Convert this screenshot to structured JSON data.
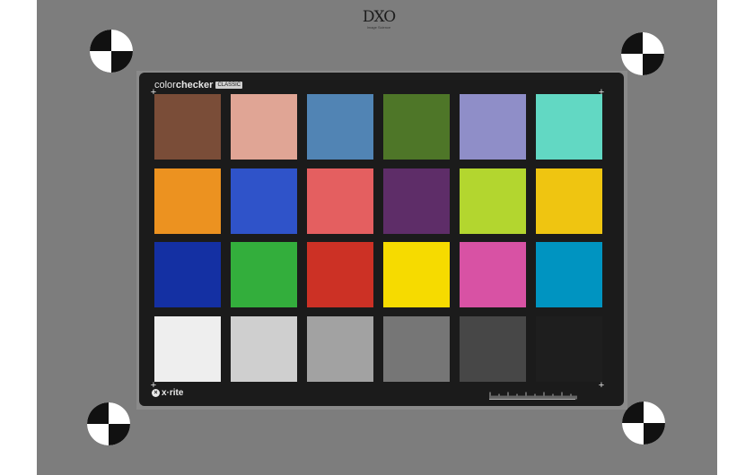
{
  "branding": {
    "dxo_logo": "DXO",
    "dxo_tagline": "Image Science",
    "chart_name_light": "color",
    "chart_name_bold": "checker",
    "chart_edition": "CLASSIC",
    "maker_logo": "x·rite"
  },
  "colors": {
    "board": "#7d7d7d",
    "chart_frame": "#1b1b1b"
  },
  "swatches": [
    [
      "#7a4d38",
      "#e0a595",
      "#5184b4",
      "#4e7628",
      "#8f8ec8",
      "#62d8c3"
    ],
    [
      "#ec9220",
      "#2f53c9",
      "#e45f60",
      "#5e2d68",
      "#b3d62f",
      "#efc511"
    ],
    [
      "#1430a3",
      "#33ae3c",
      "#cc3125",
      "#f6db00",
      "#d852a4",
      "#0094c1"
    ],
    [
      "#eeeeee",
      "#cfcfcf",
      "#a2a2a2",
      "#767676",
      "#474747",
      "#1e1e1e"
    ]
  ],
  "icons": {
    "registration_target": "quadrant-target-icon",
    "crop_mark": "crosshair-icon"
  }
}
